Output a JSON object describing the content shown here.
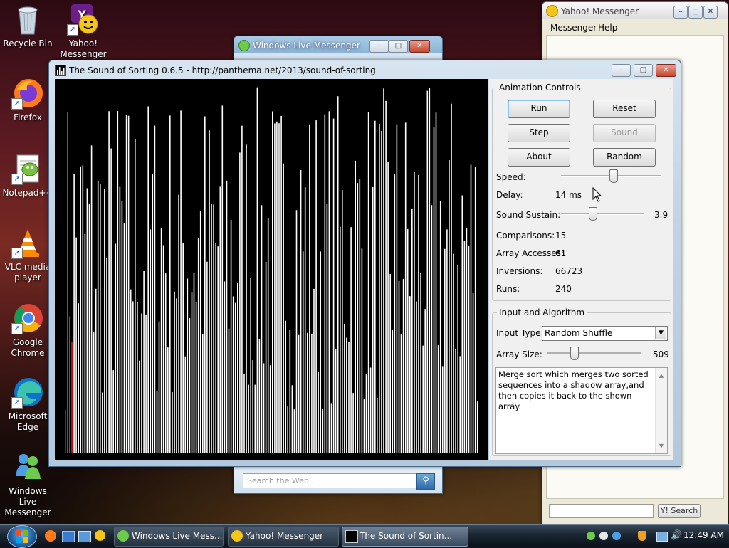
{
  "desktop": {
    "icons": [
      {
        "label": "Recycle Bin"
      },
      {
        "label": "Yahoo! Messenger"
      },
      {
        "label": "Firefox"
      },
      {
        "label": "Notepad++"
      },
      {
        "label": "VLC media player"
      },
      {
        "label": "Google Chrome"
      },
      {
        "label": "Microsoft Edge"
      },
      {
        "label": "Windows Live Messenger"
      }
    ]
  },
  "wlm_window": {
    "title": "Windows Live Messenger",
    "search_placeholder": "Search the Web..."
  },
  "yahoo_window": {
    "title": "Yahoo! Messenger",
    "menu": [
      "Messenger",
      "Help"
    ],
    "search_button": "Y! Search"
  },
  "sort_window": {
    "title": "The Sound of Sorting 0.6.5 - http://panthema.net/2013/sound-of-sorting",
    "animation_controls": {
      "title": "Animation Controls",
      "buttons": {
        "run": "Run",
        "reset": "Reset",
        "step": "Step",
        "sound": "Sound",
        "about": "About",
        "random": "Random"
      },
      "speed_label": "Speed:",
      "speed_level": 0.52,
      "delay_label": "Delay:",
      "delay_value": "14 ms",
      "sustain_label": "Sound Sustain:",
      "sustain_value": "3.9",
      "sustain_level": 0.37,
      "stats": [
        {
          "label": "Comparisons:",
          "value": "15"
        },
        {
          "label": "Array Accesses:",
          "value": "61"
        },
        {
          "label": "Inversions:",
          "value": "66723"
        },
        {
          "label": "Runs:",
          "value": "240"
        }
      ]
    },
    "input_algorithm": {
      "title": "Input and Algorithm",
      "input_type_label": "Input Type:",
      "input_type_value": "Random Shuffle",
      "array_size_label": "Array Size:",
      "array_size_value": "509",
      "array_size_level": 0.27,
      "description": "Merge sort which merges two sorted sequences into a shadow array,and then copies it back to the shown array."
    }
  },
  "taskbar": {
    "tasks": [
      {
        "label": "Windows Live Mess..."
      },
      {
        "label": "Yahoo! Messenger"
      },
      {
        "label": "The Sound of Sortin..."
      }
    ],
    "clock": "12:49 AM"
  },
  "colors": {
    "viz_background": "#000000",
    "bar_color": "#ffffff",
    "sorted_prefix_color": "#1a9a1a",
    "highlight_color": "#c82020"
  }
}
